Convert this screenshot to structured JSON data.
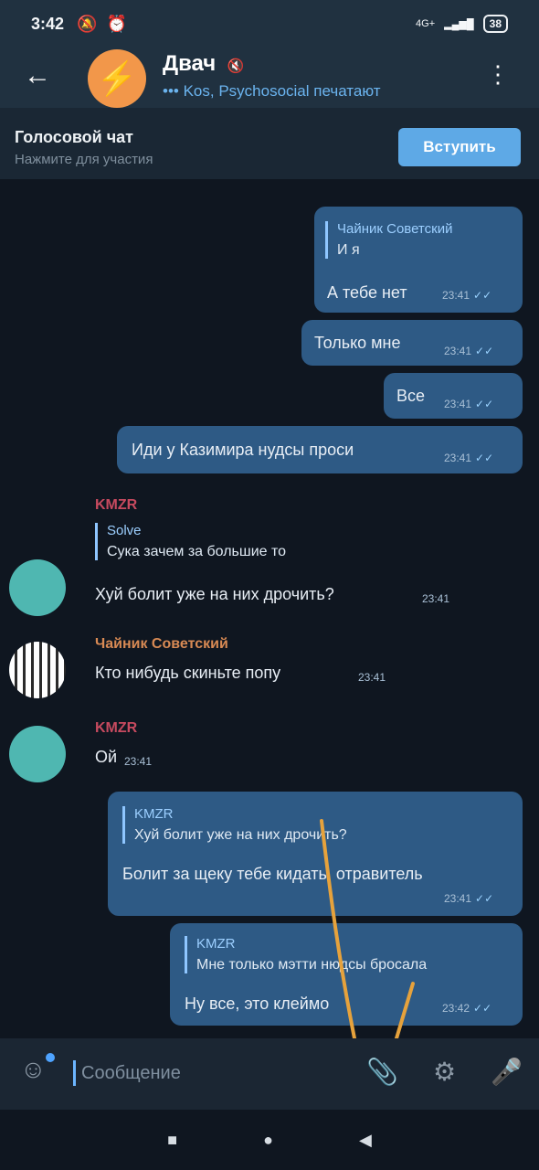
{
  "status_bar": {
    "time": "3:42",
    "icons": [
      "🔕",
      "⏰"
    ],
    "network": "4G+",
    "signal": "▂▄▆█",
    "battery": "38"
  },
  "header": {
    "back_label": "←",
    "channel_icon": "⚡",
    "title": "Двач",
    "mute_icon": "🔇",
    "typing": "••• Kos, Psychosocial печатают",
    "menu_label": "⋮"
  },
  "voice_chat": {
    "title": "Голосовой чат",
    "subtitle": "Нажмите для участия",
    "join_label": "Вступить"
  },
  "messages": [
    {
      "id": "m1",
      "reply_name": "Чайник Советский",
      "reply_text": "И я",
      "text": "А тебе нет",
      "time": "23:41"
    },
    {
      "id": "m2",
      "text": "Только мне",
      "time": "23:41"
    },
    {
      "id": "m3",
      "text": "Все",
      "time": "23:41"
    },
    {
      "id": "m4",
      "text": "Иди у Казимира нудсы проси",
      "time": "23:41"
    },
    {
      "id": "m5",
      "sender": "KMZR",
      "reply_name": "Solve",
      "reply_text": "Сука зачем за большие то",
      "text": "Хуй болит уже на них дрочить?",
      "time": "23:41"
    },
    {
      "id": "m6",
      "sender": "Чайник Советский",
      "text": "Кто нибудь скиньте попу",
      "time": "23:41"
    },
    {
      "id": "m7",
      "sender": "KMZR",
      "text": "Ой",
      "time": "23:41"
    },
    {
      "id": "m8",
      "reply_name": "KMZR",
      "reply_text": "Хуй болит уже на них дрочить?",
      "text": "Болит за щеку тебе кидать, отравитель",
      "time": "23:41"
    },
    {
      "id": "m9",
      "reply_name": "KMZR",
      "reply_text": "Мне только мэтти нюдсы бросала",
      "text": "Ну все, это клеймо",
      "time": "23:42"
    }
  ],
  "colors": {
    "kmzr": "#c74a5f",
    "chainik": "#d88a54",
    "annotation_arrow": "#e6a23c"
  },
  "composer": {
    "emoji_icon": "☺",
    "placeholder": "Сообщение",
    "attach_icon": "📎",
    "camera_icon": "⚙",
    "mic_icon": "🎤"
  },
  "nav": {
    "recent": "■",
    "home": "●",
    "back": "◀"
  }
}
